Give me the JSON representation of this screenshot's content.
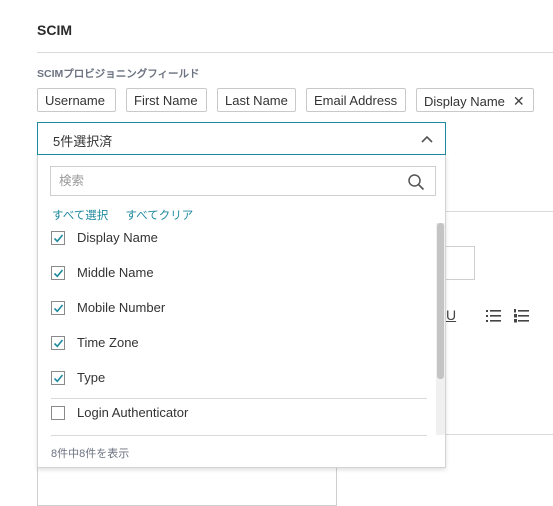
{
  "section": {
    "title": "SCIM"
  },
  "field": {
    "label": "SCIMプロビジョニングフィールド"
  },
  "chips": [
    {
      "label": "Username"
    },
    {
      "label": "First Name"
    },
    {
      "label": "Last Name"
    },
    {
      "label": "Email Address"
    },
    {
      "label": "Display Name",
      "remove": "✕"
    }
  ],
  "select": {
    "value": "5件選択済",
    "icon": "chevron-up-icon"
  },
  "search": {
    "placeholder": "検索",
    "icon": "search-icon"
  },
  "bulk": {
    "select_all": "すべて選択",
    "clear_all": "すべてクリア"
  },
  "options": [
    {
      "label": "Display Name",
      "checked": true
    },
    {
      "label": "Middle Name",
      "checked": true
    },
    {
      "label": "Mobile Number",
      "checked": true
    },
    {
      "label": "Time Zone",
      "checked": true
    },
    {
      "label": "Type",
      "checked": true
    },
    {
      "label": "Login Authenticator",
      "checked": false
    }
  ],
  "footer": {
    "count_text": "8件中8件を表示"
  },
  "background": {
    "toolbar_underline": "U"
  },
  "colors": {
    "accent": "#1f8a9e",
    "border": "#cfcfcf"
  }
}
